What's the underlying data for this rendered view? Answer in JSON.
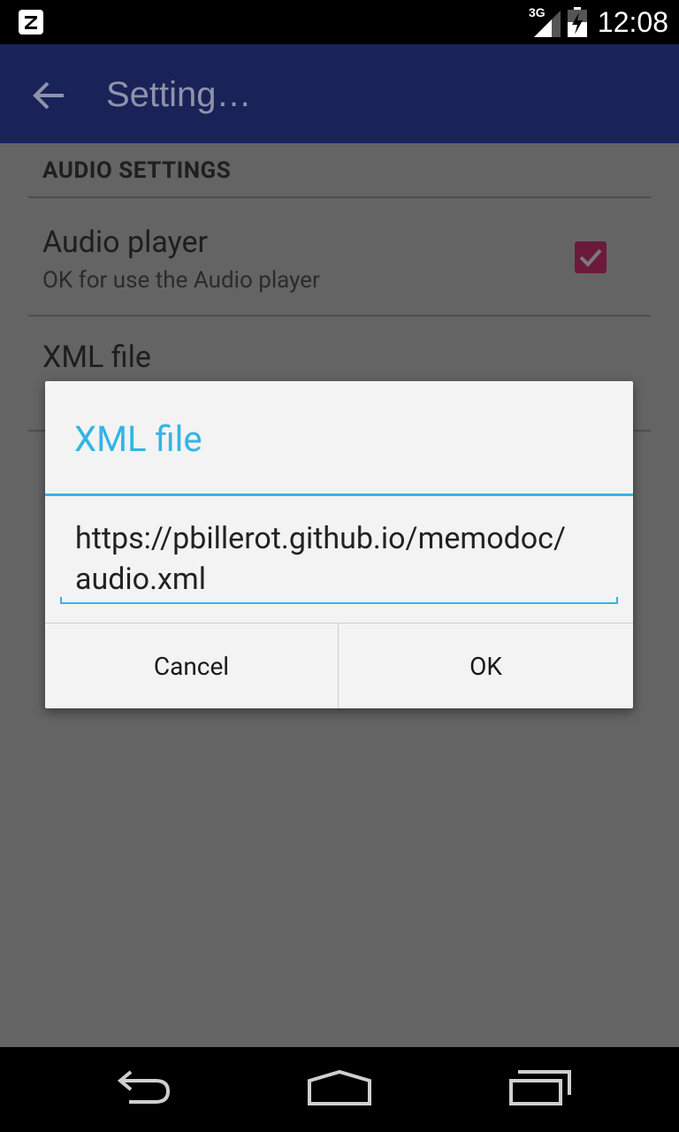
{
  "status_bar": {
    "time": "12:08",
    "network": "3G",
    "left_icon": "notification-z-icon"
  },
  "app_bar": {
    "title": "Setting…",
    "back_icon": "arrow-back-icon"
  },
  "settings": {
    "section_header": "AUDIO SETTINGS",
    "items": [
      {
        "title": "Audio player",
        "summary": "OK for use the Audio player",
        "checked": true
      },
      {
        "title": "XML file"
      }
    ]
  },
  "dialog": {
    "title": "XML file",
    "input_value": "https://pbillerot.github.io/memodoc/\naudio.xml",
    "cancel_label": "Cancel",
    "ok_label": "OK"
  },
  "nav_bar": {
    "back_icon": "nav-back-icon",
    "home_icon": "nav-home-icon",
    "recents_icon": "nav-recents-icon"
  },
  "colors": {
    "app_bar": "#1a2358",
    "accent": "#33b5e5",
    "checkbox": "#6b1a3b",
    "scrim_bg": "#646464",
    "dialog_bg": "#f3f3f3"
  }
}
